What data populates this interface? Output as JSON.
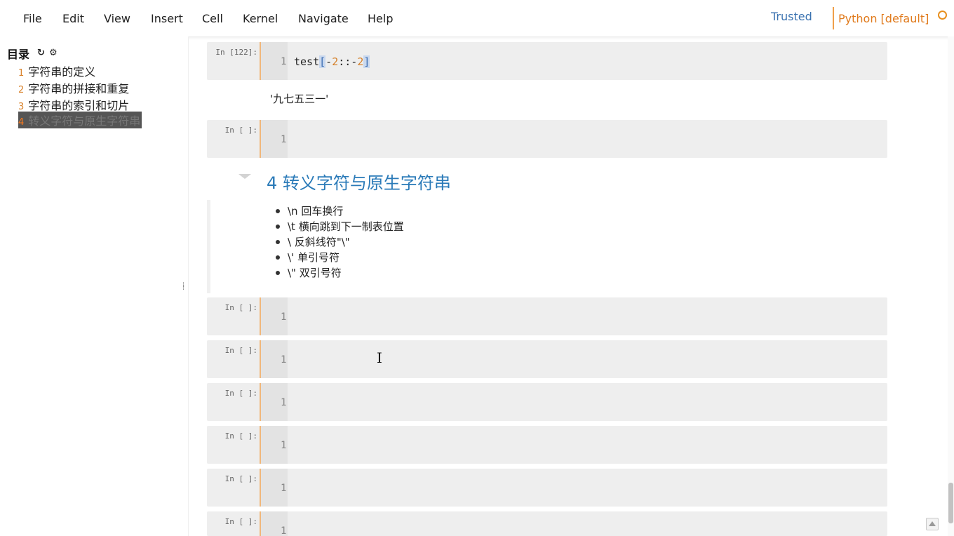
{
  "menu": {
    "file": "File",
    "edit": "Edit",
    "view": "View",
    "insert": "Insert",
    "cell": "Cell",
    "kernel": "Kernel",
    "navigate": "Navigate",
    "help": "Help"
  },
  "status": {
    "trusted": "Trusted",
    "kernel_name": "Python [default]"
  },
  "toc": {
    "title": "目录",
    "items": [
      {
        "num": "1",
        "label": "字符串的定义"
      },
      {
        "num": "2",
        "label": "字符串的拼接和重复"
      },
      {
        "num": "3",
        "label": "字符串的索引和切片"
      },
      {
        "num": "4",
        "label": "转义字符与原生字符串"
      }
    ]
  },
  "cells": {
    "c1": {
      "prompt": "In [122]:",
      "line": "1",
      "code_prefix": "test",
      "bracket_open": "[",
      "minus1": "-",
      "n1": "2",
      "sep": "::",
      "minus2": "-",
      "n2": "2",
      "bracket_close": "]"
    },
    "c1_output": "'九七五三一'",
    "c2": {
      "prompt": "In [ ]:",
      "line": "1"
    },
    "c3": {
      "prompt": "In [ ]:",
      "line": "1"
    },
    "c4": {
      "prompt": "In [ ]:",
      "line": "1"
    },
    "c5": {
      "prompt": "In [ ]:",
      "line": "1"
    },
    "c6": {
      "prompt": "In [ ]:",
      "line": "1"
    },
    "c7": {
      "prompt": "In [ ]:",
      "line": "1"
    },
    "c8": {
      "prompt": "In [ ]:",
      "line": "1"
    }
  },
  "markdown": {
    "heading": "4  转义字符与原生字符串",
    "bullets": [
      "\\n 回车换行",
      "\\t 横向跳到下一制表位置",
      "\\ 反斜线符\"\\\"",
      "\\' 单引号符",
      "\\\" 双引号符"
    ]
  },
  "colors": {
    "accent_orange": "#e07a1c",
    "link_blue": "#3a72b0",
    "heading_blue": "#2a7ab8",
    "cell_border": "#f0b77a"
  }
}
